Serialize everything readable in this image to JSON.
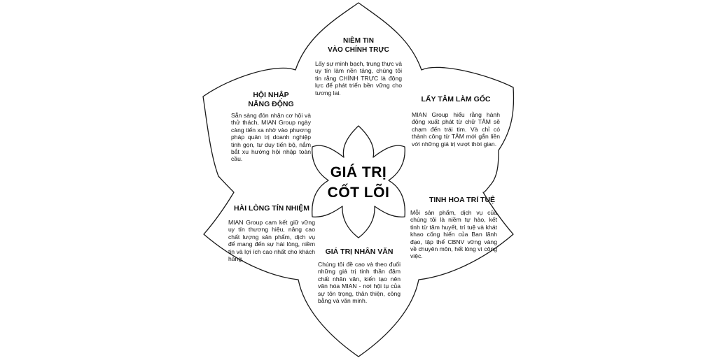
{
  "center": {
    "line1": "GIÁ TRỊ",
    "line2": "CỐT LÕI"
  },
  "petals": {
    "top": {
      "title_line1": "NIỀM TIN",
      "title_line2": "VÀO CHÍNH TRỰC",
      "body": "Lấy sự minh bạch, trung thực và uy tín làm nền tảng, chúng tôi tin rằng CHÍNH TRỰC là động lực để phát triển bền vững cho tương lai."
    },
    "top_right": {
      "title": "LẤY TÂM LÀM GỐC",
      "body": "MIAN Group hiểu rằng hành động xuất phát từ chữ TÂM sẽ chạm đến trái tim. Và chỉ có thành công từ TÂM mới gắn liền với những giá trị vượt thời gian."
    },
    "bottom_right": {
      "title": "TINH HOA TRÍ TUỆ",
      "body": "Mỗi sản phẩm, dịch vụ của chúng tôi là niềm tự hào, kết tinh từ tâm huyết, trí tuệ và khát khao cống hiến của Ban lãnh đạo, tập thể CBNV vững vàng về chuyên môn, hết lòng vì công việc."
    },
    "bottom": {
      "title": "GIÁ TRỊ NHÂN VĂN",
      "body": "Chúng tôi đề cao và theo đuổi những giá trị tinh thần đậm chất nhân văn, kiến tạo nên văn hóa MIAN - nơi hội tụ của sự tôn trọng, thân thiện, công bằng và văn minh."
    },
    "bottom_left": {
      "title": "HÀI LÒNG TÍN NHIỆM",
      "body": "MIAN Group cam kết giữ vững uy tín thương hiệu, nâng cao chất lượng sản phẩm, dịch vụ để mang đến sự hài lòng, niềm tin và lợi ích cao nhất cho khách hàng."
    },
    "top_left": {
      "title_line1": "HỘI NHẬP",
      "title_line2": "NĂNG ĐỘNG",
      "body": "Sẵn sàng đón nhận cơ hội và thử thách, MIAN Group ngày càng tiến xa nhờ vào phương pháp quản trị doanh nghiệp tinh gọn, tư duy tiến bộ, nắm bắt xu hướng hội nhập toàn cầu."
    }
  }
}
